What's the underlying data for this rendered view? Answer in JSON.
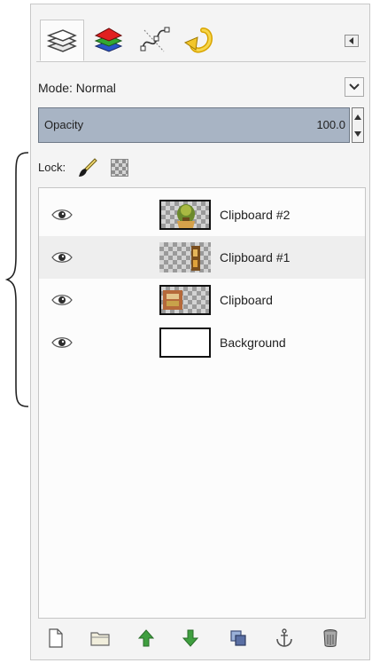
{
  "panel": {
    "tabs": [
      {
        "name": "layers-tab",
        "icon": "layers-icon",
        "active": true
      },
      {
        "name": "channels-tab",
        "icon": "channels-icon",
        "active": false
      },
      {
        "name": "paths-tab",
        "icon": "paths-icon",
        "active": false
      },
      {
        "name": "undo-history-tab",
        "icon": "undo-icon",
        "active": false
      }
    ],
    "tab_menu_icon": "tab-menu-icon"
  },
  "mode": {
    "label": "Mode: Normal",
    "dropdown_icon": "chevron-down-icon"
  },
  "opacity": {
    "label": "Opacity",
    "value": "100.0"
  },
  "lock": {
    "label": "Lock:",
    "icons": [
      "lock-pixels-icon",
      "lock-alpha-icon"
    ]
  },
  "layers": [
    {
      "name": "Clipboard #2",
      "visible": true,
      "thumb": "image-with-transparency"
    },
    {
      "name": "Clipboard #1",
      "visible": true,
      "thumb": "image-with-transparency"
    },
    {
      "name": "Clipboard",
      "visible": true,
      "thumb": "image-with-transparency"
    },
    {
      "name": "Background",
      "visible": true,
      "thumb": "white"
    }
  ],
  "toolbar": {
    "buttons": [
      "new-layer-icon",
      "new-layer-group-icon",
      "raise-layer-icon",
      "lower-layer-icon",
      "duplicate-layer-icon",
      "anchor-layer-icon",
      "delete-layer-icon"
    ]
  },
  "colors": {
    "opacity_fill": "#a8b4c4",
    "selected_row": "#eeeeee",
    "raise_lower_green": "#3f9f3f"
  }
}
